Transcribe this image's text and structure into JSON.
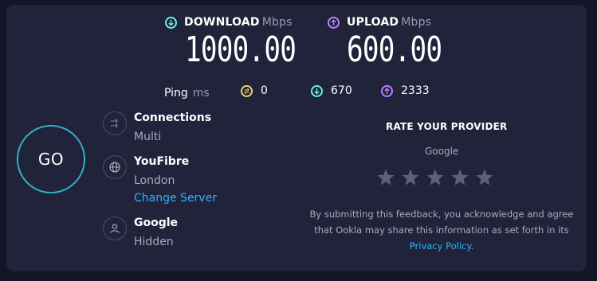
{
  "download": {
    "label": "DOWNLOAD",
    "unit": "Mbps",
    "value": "1000.00"
  },
  "upload": {
    "label": "UPLOAD",
    "unit": "Mbps",
    "value": "600.00"
  },
  "ping": {
    "label": "Ping",
    "unit": "ms",
    "idle": "0",
    "download": "670",
    "upload": "2333"
  },
  "go_label": "GO",
  "connections": {
    "title": "Connections",
    "value": "Multi"
  },
  "server": {
    "title": "YouFibre",
    "location": "London",
    "change_label": "Change Server"
  },
  "provider": {
    "title": "Google",
    "value": "Hidden"
  },
  "rate": {
    "title": "RATE YOUR PROVIDER",
    "provider": "Google",
    "stars_count": 5,
    "disclaimer_before": "By submitting this feedback, you acknowledge and agree that Ookla may share this information as set forth in its ",
    "disclaimer_link": "Privacy Policy",
    "disclaimer_after": "."
  },
  "colors": {
    "background": "#141526",
    "card": "#20233a",
    "download_accent": "#6af1e0",
    "upload_accent": "#bf7fff",
    "ping_accent": "#f3d35a",
    "go_ring": "#2fb2c6",
    "link": "#2fb4ff"
  },
  "icons": [
    "download-arrow-icon",
    "upload-arrow-icon",
    "ping-icon",
    "connections-icon",
    "globe-icon",
    "user-icon",
    "star-icon"
  ]
}
